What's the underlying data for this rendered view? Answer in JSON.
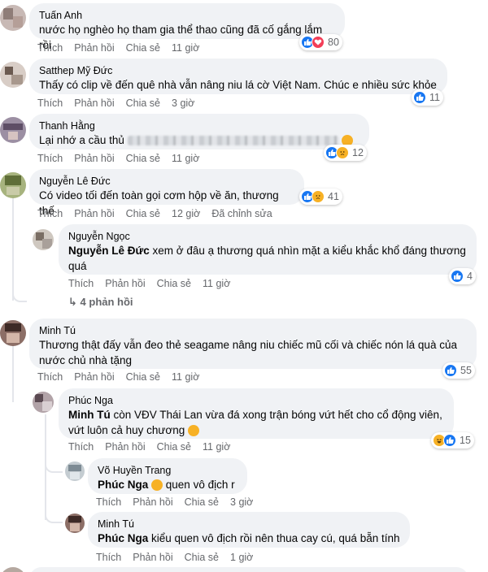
{
  "actions": {
    "like": "Thích",
    "reply": "Phản hồi",
    "share": "Chia sẻ",
    "edited": "Đã chỉnh sửa"
  },
  "comments": [
    {
      "author": "Tuấn Anh",
      "text": "nước họ nghèo họ tham gia thể thao cũng đã cố gắng lắm rồi",
      "time": "11 giờ",
      "reactions": "80"
    },
    {
      "author": "Satthep Mỹ Đức",
      "text": "Thấy có clip về đến quê nhà vẫn nâng niu lá cờ Việt Nam. Chúc e nhiều sức khỏe",
      "time": "3 giờ",
      "reactions": "11"
    },
    {
      "author": "Thanh Hằng",
      "text": "Lại nhớ a cầu thủ",
      "time": "11 giờ",
      "reactions": "12"
    },
    {
      "author": "Nguyễn Lê Đức",
      "text": "Có video tối đến toàn gọi cơm hộp về ăn, thương thế",
      "time": "12 giờ",
      "reactions": "41"
    },
    {
      "author": "Nguyễn Ngọc",
      "tag": "Nguyễn Lê Đức",
      "text": " xem ở đâu ạ thương quá nhìn mặt a kiểu khắc khổ đáng thương",
      "text2": "quá",
      "time": "11 giờ",
      "reactions": "4"
    },
    {
      "author": "Minh Tú",
      "text": "Thương thật đấy vẫn đeo thẻ seagame nâng niu chiếc mũ cối và chiếc nón lá quà của",
      "text2": "nước chủ nhà tặng",
      "time": "11 giờ",
      "reactions": "55"
    },
    {
      "author": "Phúc Nga",
      "tag": "Minh Tú",
      "text": " còn VĐV Thái Lan vừa đá xong trận bóng vứt hết cho cổ động viên,",
      "text2": "vứt luôn cả huy chương",
      "time": "11 giờ",
      "reactions": "15"
    },
    {
      "author": "Võ Huyền Trang",
      "tag": "Phúc Nga",
      "text": " quen vô địch r",
      "time": "3 giờ"
    },
    {
      "author": "Minh Tú",
      "tag": "Phúc Nga",
      "text": " kiểu quen vô địch rồi nên thua cay cú, quá bẵn tính",
      "time": "1 giờ"
    }
  ],
  "view_replies": "4 phản hồi",
  "colors": {
    "like": "#1877f2",
    "love": "#f33e58",
    "sad": "#f7b125",
    "bubble": "#f0f2f5",
    "meta": "#65676b"
  }
}
